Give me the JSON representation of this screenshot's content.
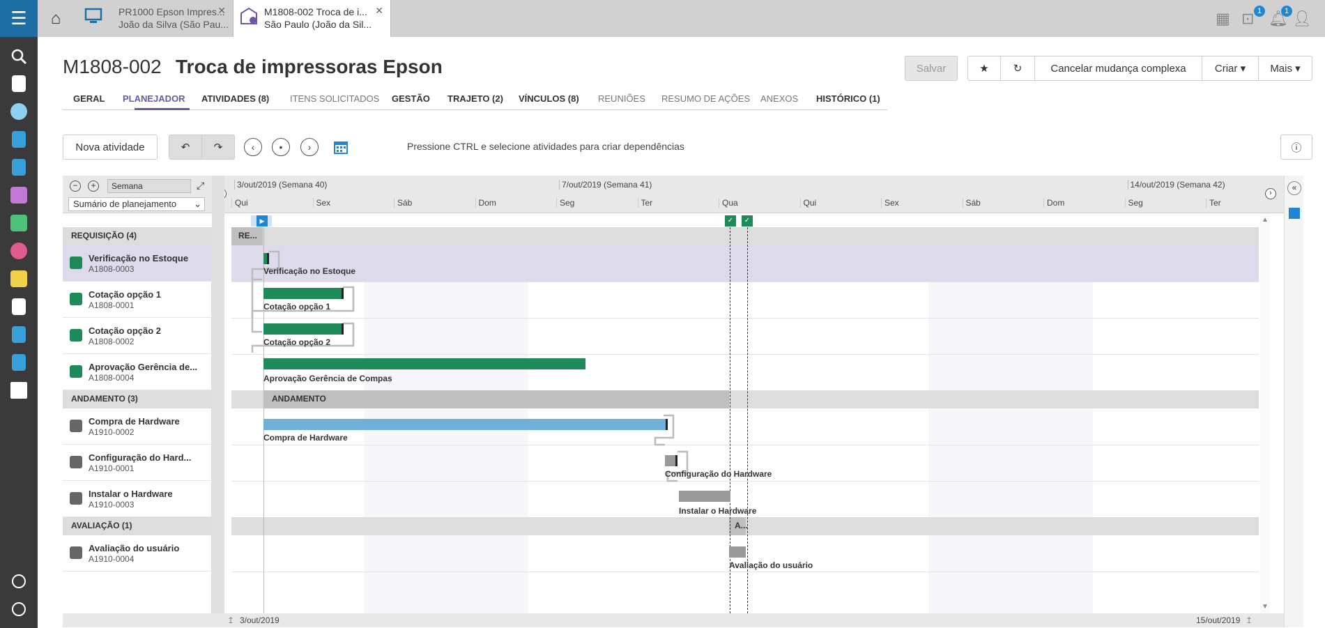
{
  "rail": {
    "menu_icon": "hamburger-icon"
  },
  "tabs": [
    {
      "line1": "PR1000 Epson Impres...",
      "line2": "João da Silva (São Pau..."
    },
    {
      "line1": "M1808-002 Troca de i...",
      "line2": "São Paulo (João da Sil..."
    }
  ],
  "badges": {
    "cart": "1",
    "bell": "1"
  },
  "header": {
    "code": "M1808-002",
    "title": "Troca de impressoras Epson"
  },
  "actions": {
    "save": "Salvar",
    "cancel": "Cancelar mudança complexa",
    "create": "Criar",
    "more": "Mais"
  },
  "nav": [
    {
      "label": "GERAL",
      "style": "bold"
    },
    {
      "label": "PLANEJADOR",
      "style": "active"
    },
    {
      "label": "ATIVIDADES (8)",
      "style": "bold"
    },
    {
      "label": "ITENS SOLICITADOS",
      "style": "light"
    },
    {
      "label": "GESTÃO",
      "style": "bold"
    },
    {
      "label": "TRAJETO (2)",
      "style": "bold"
    },
    {
      "label": "VÍNCULOS (8)",
      "style": "bold"
    },
    {
      "label": "REUNIÕES",
      "style": "light"
    },
    {
      "label": "RESUMO DE AÇÕES",
      "style": "light"
    },
    {
      "label": "ANEXOS",
      "style": "light"
    },
    {
      "label": "HISTÓRICO (1)",
      "style": "bold"
    }
  ],
  "toolbar": {
    "new_activity": "Nova atividade",
    "hint": "Pressione CTRL e selecione atividades para criar dependências"
  },
  "gantt": {
    "scale": "Semana",
    "summary_select": "Sumário de planejamento",
    "weeks": [
      "3/out/2019 (Semana 40)",
      "7/out/2019 (Semana 41)",
      "14/out/2019 (Semana 42)"
    ],
    "days": [
      "Qui",
      "Sex",
      "Sáb",
      "Dom",
      "Seg",
      "Ter",
      "Qua",
      "Qui",
      "Sex",
      "Sáb",
      "Dom",
      "Seg",
      "Ter"
    ],
    "footer_start": "3/out/2019",
    "footer_end": "15/out/2019",
    "groups": {
      "req": {
        "label": "REQUISIÇÃO  (4)",
        "bar": "RE..."
      },
      "and": {
        "label": "ANDAMENTO  (3)",
        "bar": "ANDAMENTO"
      },
      "ava": {
        "label": "AVALIAÇÃO  (1)",
        "bar": "A..."
      }
    },
    "tasks": [
      {
        "name": "Verificação no Estoque",
        "code": "A1808-0003",
        "bar": "Verificação no Estoque"
      },
      {
        "name": "Cotação opção 1",
        "code": "A1808-0001",
        "bar": "Cotação opção 1"
      },
      {
        "name": "Cotação opção 2",
        "code": "A1808-0002",
        "bar": "Cotação opção 2"
      },
      {
        "name": "Aprovação Gerência de...",
        "code": "A1808-0004",
        "bar": "Aprovação Gerência de Compas"
      },
      {
        "name": "Compra de Hardware",
        "code": "A1910-0002",
        "bar": "Compra de Hardware"
      },
      {
        "name": "Configuração do Hard...",
        "code": "A1910-0001",
        "bar": "Configuração do Hardware"
      },
      {
        "name": "Instalar o Hardware",
        "code": "A1910-0003",
        "bar": "Instalar o Hardware"
      },
      {
        "name": "Avaliação do usuário",
        "code": "A1910-0004",
        "bar": "Avaliação do usuário"
      }
    ],
    "colors": {
      "done": "#1e8a5a",
      "in_progress": "#6fb0d6",
      "pending": "#9a9a9a",
      "group": "#bfbfbf",
      "accent": "#6d56a8"
    }
  }
}
